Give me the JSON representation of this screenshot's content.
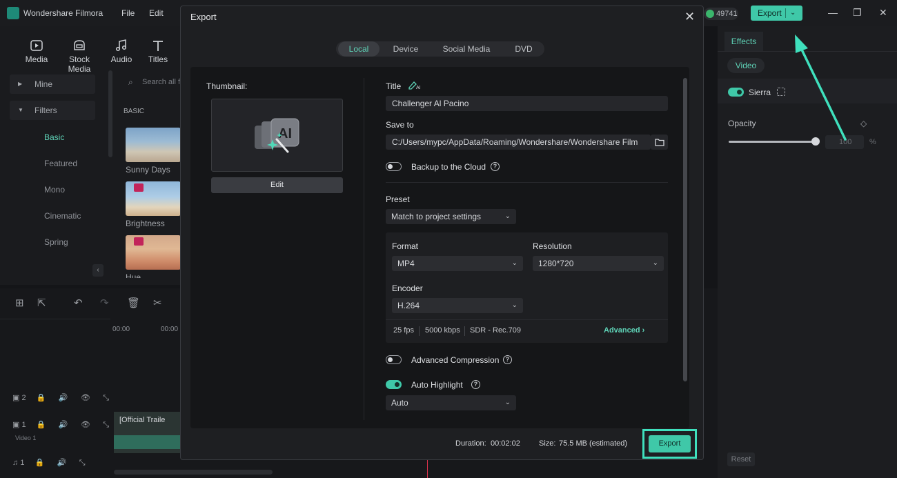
{
  "app": {
    "name": "Wondershare Filmora",
    "menu": [
      "File",
      "Edit"
    ],
    "credits": "49741",
    "export_label": "Export",
    "media_tabs": [
      "Media",
      "Stock Media",
      "Audio",
      "Titles"
    ],
    "sidebar": {
      "mine": "Mine",
      "filters": "Filters",
      "subs": [
        "Basic",
        "Featured",
        "Mono",
        "Cinematic",
        "Spring"
      ]
    },
    "search_placeholder": "Search all f",
    "section_label": "BASIC",
    "thumbs": [
      "Sunny Days",
      "Brightness",
      "Hue"
    ],
    "timeline": {
      "timecodes": [
        "00:00",
        "00:00"
      ],
      "track_numbers": [
        "2",
        "1",
        "1"
      ],
      "video_track_label": "Video 1",
      "clip_title": "[Official Traile"
    },
    "right_panel": {
      "effects_tab": "Effects",
      "video_pill": "Video",
      "effect_name": "Sierra",
      "opacity_label": "Opacity",
      "opacity_value": "100",
      "opacity_unit": "%",
      "opacity_level": 1.0,
      "reset_label": "Reset"
    }
  },
  "dialog": {
    "title": "Export",
    "tabs": [
      "Local",
      "Device",
      "Social Media",
      "DVD"
    ],
    "active_tab": "Local",
    "thumbnail_label": "Thumbnail:",
    "edit_label": "Edit",
    "title_label": "Title",
    "title_value": "Challenger Al Pacino",
    "save_to_label": "Save to",
    "save_to_value": "C:/Users/mypc/AppData/Roaming/Wondershare/Wondershare Film",
    "backup_label": "Backup to the Cloud",
    "backup_on": false,
    "preset_label": "Preset",
    "preset_value": "Match to project settings",
    "format_label": "Format",
    "format_value": "MP4",
    "resolution_label": "Resolution",
    "resolution_value": "1280*720",
    "encoder_label": "Encoder",
    "encoder_value": "H.264",
    "fps": "25 fps",
    "bitrate": "5000 kbps",
    "color_space": "SDR - Rec.709",
    "advanced_label": "Advanced",
    "adv_compression_label": "Advanced Compression",
    "adv_compression_on": false,
    "auto_highlight_label": "Auto Highlight",
    "auto_highlight_on": true,
    "auto_highlight_value": "Auto",
    "duration_label": "Duration:",
    "duration_value": "00:02:02",
    "size_label": "Size:",
    "size_value": "75.5 MB (estimated)",
    "export_label": "Export"
  },
  "colors": {
    "accent": "#3fc8a8",
    "highlight": "#3fe0bd",
    "dialog_bg": "#1e1f22",
    "content_bg": "#151618"
  }
}
